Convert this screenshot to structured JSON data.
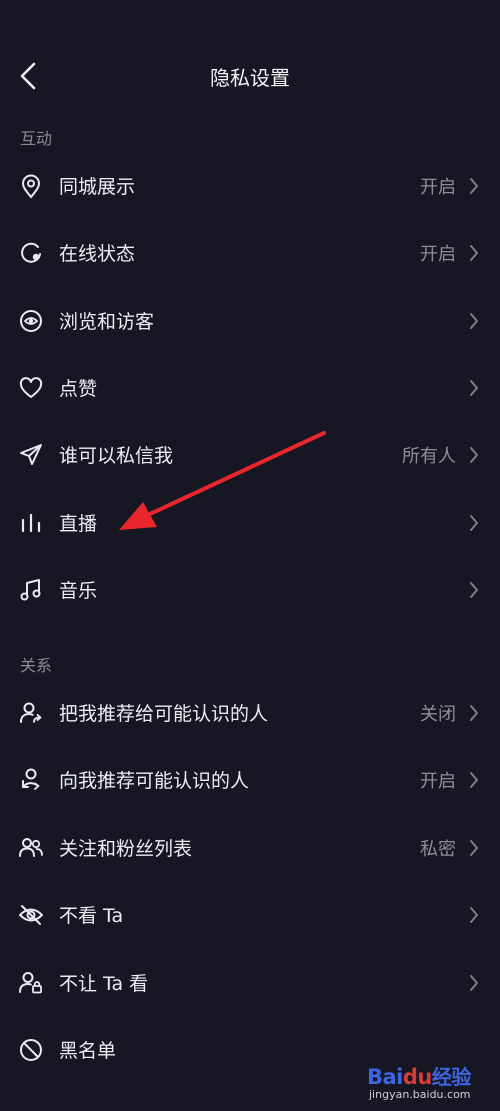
{
  "header": {
    "title": "隐私设置",
    "back_icon": "back-arrow-icon"
  },
  "sections": [
    {
      "title": "互动"
    },
    {
      "title": "关系"
    }
  ],
  "rows": [
    {
      "label": "同城展示",
      "value": "开启",
      "icon": "location-pin-icon"
    },
    {
      "label": "在线状态",
      "value": "开启",
      "icon": "online-status-icon"
    },
    {
      "label": "浏览和访客",
      "value": "",
      "icon": "eye-icon"
    },
    {
      "label": "点赞",
      "value": "",
      "icon": "heart-icon"
    },
    {
      "label": "谁可以私信我",
      "value": "所有人",
      "icon": "paper-plane-icon"
    },
    {
      "label": "直播",
      "value": "",
      "icon": "live-bars-icon"
    },
    {
      "label": "音乐",
      "value": "",
      "icon": "music-note-icon"
    },
    {
      "label": "把我推荐给可能认识的人",
      "value": "关闭",
      "icon": "user-share-icon"
    },
    {
      "label": "向我推荐可能认识的人",
      "value": "开启",
      "icon": "user-recommend-icon"
    },
    {
      "label": "关注和粉丝列表",
      "value": "私密",
      "icon": "users-icon"
    },
    {
      "label": "不看 Ta",
      "value": "",
      "icon": "eye-off-icon"
    },
    {
      "label": "不让 Ta 看",
      "value": "",
      "icon": "user-lock-icon"
    },
    {
      "label": "黑名单",
      "value": "",
      "icon": "block-icon"
    }
  ],
  "annotation": {
    "color": "#e8262d"
  },
  "watermark": {
    "brand": "Bai",
    "brand_paw": "du",
    "brand_cn": "经验",
    "domain": "jingyan.baidu.com"
  },
  "colors": {
    "background": "#161722",
    "text": "#ececf1",
    "muted": "#8d8e98"
  }
}
